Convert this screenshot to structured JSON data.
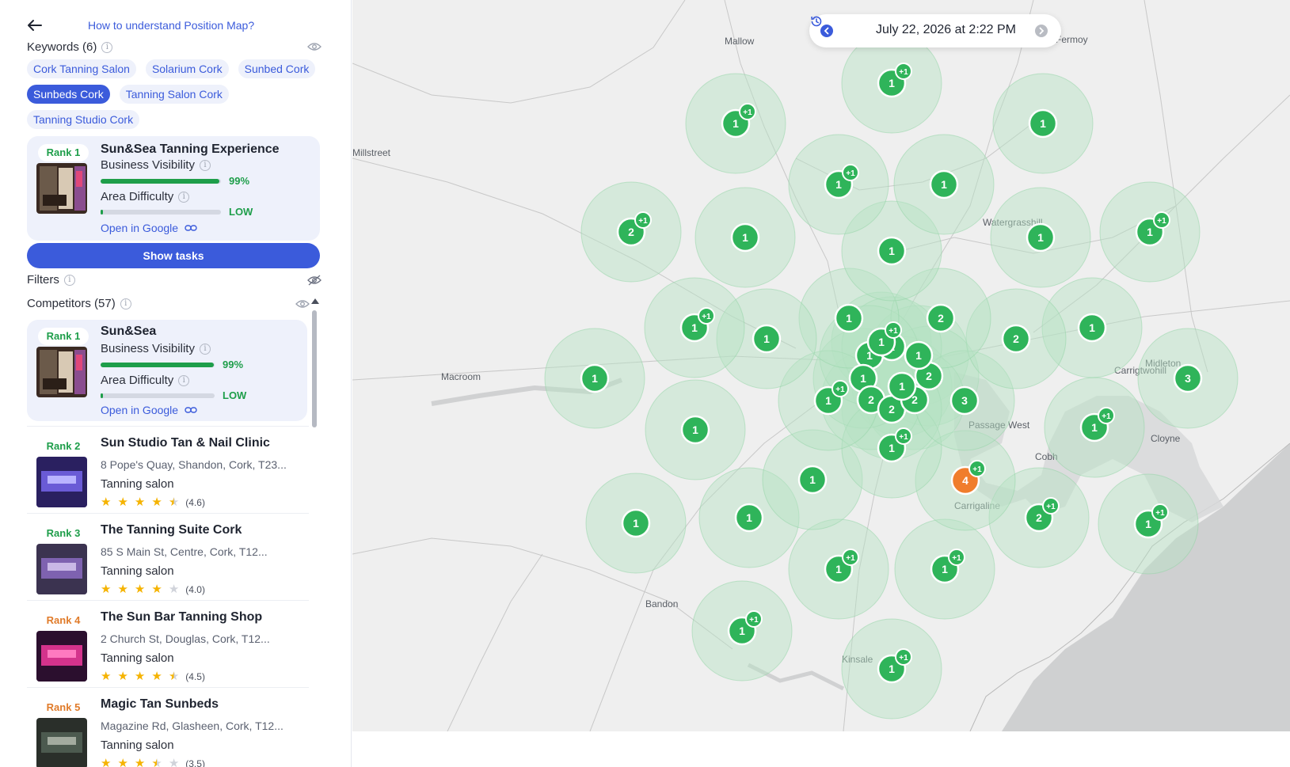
{
  "header": {
    "help_link": "How to understand Position Map?"
  },
  "keywords": {
    "heading": "Keywords (6)",
    "items": [
      {
        "label": "Cork Tanning Salon",
        "active": false
      },
      {
        "label": "Solarium Cork",
        "active": false
      },
      {
        "label": "Sunbed Cork",
        "active": false
      },
      {
        "label": "Sunbeds Cork",
        "active": true
      },
      {
        "label": "Tanning Salon Cork",
        "active": false
      },
      {
        "label": "Tanning Studio Cork",
        "active": false
      }
    ]
  },
  "my_business": {
    "rank": "Rank 1",
    "name": "Sun&Sea Tanning Experience",
    "visibility_label": "Business Visibility",
    "visibility_value": "99%",
    "visibility_fraction": 0.99,
    "difficulty_label": "Area Difficulty",
    "difficulty_value": "LOW",
    "difficulty_fraction": 0.02,
    "open_link": "Open in Google",
    "show_tasks": "Show tasks"
  },
  "filters": {
    "heading": "Filters"
  },
  "competitors": {
    "heading": "Competitors (57)",
    "top": {
      "rank": "Rank 1",
      "name": "Sun&Sea",
      "visibility_label": "Business Visibility",
      "visibility_value": "99%",
      "visibility_fraction": 0.99,
      "difficulty_label": "Area Difficulty",
      "difficulty_value": "LOW",
      "difficulty_fraction": 0.02,
      "open_link": "Open in Google"
    },
    "list": [
      {
        "rank": "Rank 2",
        "rank_color": "green",
        "name": "Sun Studio Tan & Nail Clinic",
        "address": "8 Pope's Quay, Shandon, Cork, T23...",
        "category": "Tanning salon",
        "rating_text": "(4.6)",
        "rating": 4.6
      },
      {
        "rank": "Rank 3",
        "rank_color": "green",
        "name": "The Tanning Suite Cork",
        "address": "85 S Main St, Centre, Cork, T12...",
        "category": "Tanning salon",
        "rating_text": "(4.0)",
        "rating": 4.0
      },
      {
        "rank": "Rank 4",
        "rank_color": "orange",
        "name": "The Sun Bar Tanning Shop",
        "address": "2 Church St, Douglas, Cork, T12...",
        "category": "Tanning salon",
        "rating_text": "(4.5)",
        "rating": 4.5
      },
      {
        "rank": "Rank 5",
        "rank_color": "orange",
        "name": "Magic Tan Sunbeds",
        "address": "Magazine Rd, Glasheen, Cork, T12...",
        "category": "Tanning salon",
        "rating_text": "(3.5)",
        "rating": 3.5
      }
    ]
  },
  "map": {
    "date": "July 22, 2026 at 2:22 PM",
    "places": [
      "Mallow",
      "Fermoy",
      "Millstreet",
      "Watergrasshill",
      "Macroom",
      "Carrigtwohill",
      "Midleton",
      "Passage West",
      "Cobh",
      "Cloyne",
      "Carrigaline",
      "Bandon",
      "Kinsale"
    ],
    "colors": {
      "green": "#2fb45a",
      "orange": "#f07d2c",
      "zone_fill": "#b6e3c3"
    },
    "markers": [
      {
        "label": "1",
        "extra": "+1",
        "color": "green"
      },
      {
        "label": "1",
        "extra": "+1",
        "color": "green"
      },
      {
        "label": "1",
        "extra": "",
        "color": "green"
      },
      {
        "label": "1",
        "extra": "+1",
        "color": "green"
      },
      {
        "label": "1",
        "extra": "",
        "color": "green"
      },
      {
        "label": "2",
        "extra": "+1",
        "color": "green"
      },
      {
        "label": "1",
        "extra": "",
        "color": "green"
      },
      {
        "label": "1",
        "extra": "",
        "color": "green"
      },
      {
        "label": "1",
        "extra": "",
        "color": "green"
      },
      {
        "label": "1",
        "extra": "+1",
        "color": "green"
      },
      {
        "label": "1",
        "extra": "+1",
        "color": "green"
      },
      {
        "label": "1",
        "extra": "",
        "color": "green"
      },
      {
        "label": "1",
        "extra": "",
        "color": "green"
      },
      {
        "label": "2",
        "extra": "",
        "color": "green"
      },
      {
        "label": "2",
        "extra": "",
        "color": "green"
      },
      {
        "label": "1",
        "extra": "",
        "color": "green"
      },
      {
        "label": "1",
        "extra": "",
        "color": "green"
      },
      {
        "label": "1",
        "extra": "+1",
        "color": "green"
      },
      {
        "label": "3",
        "extra": "",
        "color": "green"
      },
      {
        "label": "1",
        "extra": "+1",
        "color": "green"
      },
      {
        "label": "3",
        "extra": "",
        "color": "green"
      },
      {
        "label": "1",
        "extra": "",
        "color": "green"
      },
      {
        "label": "1",
        "extra": "+1",
        "color": "green"
      },
      {
        "label": "1",
        "extra": "",
        "color": "green"
      },
      {
        "label": "4",
        "extra": "+1",
        "color": "orange"
      },
      {
        "label": "1",
        "extra": "",
        "color": "green"
      },
      {
        "label": "1",
        "extra": "",
        "color": "green"
      },
      {
        "label": "2",
        "extra": "+1",
        "color": "green"
      },
      {
        "label": "1",
        "extra": "+1",
        "color": "green"
      },
      {
        "label": "1",
        "extra": "+1",
        "color": "green"
      },
      {
        "label": "1",
        "extra": "+1",
        "color": "green"
      },
      {
        "label": "1",
        "extra": "+1",
        "color": "green"
      },
      {
        "label": "1",
        "extra": "+1",
        "color": "green"
      },
      {
        "label": "1",
        "extra": "+1",
        "color": "green"
      },
      {
        "label": "1",
        "extra": "",
        "color": "green"
      },
      {
        "label": "1",
        "extra": "",
        "color": "green"
      },
      {
        "label": "2",
        "extra": "",
        "color": "green"
      },
      {
        "label": "2",
        "extra": "",
        "color": "green"
      },
      {
        "label": "2",
        "extra": "",
        "color": "green"
      },
      {
        "label": "2",
        "extra": "",
        "color": "green"
      },
      {
        "label": "1",
        "extra": "",
        "color": "green"
      },
      {
        "label": "1",
        "extra": "",
        "color": "green"
      },
      {
        "label": "1",
        "extra": "+1",
        "color": "green"
      }
    ]
  }
}
